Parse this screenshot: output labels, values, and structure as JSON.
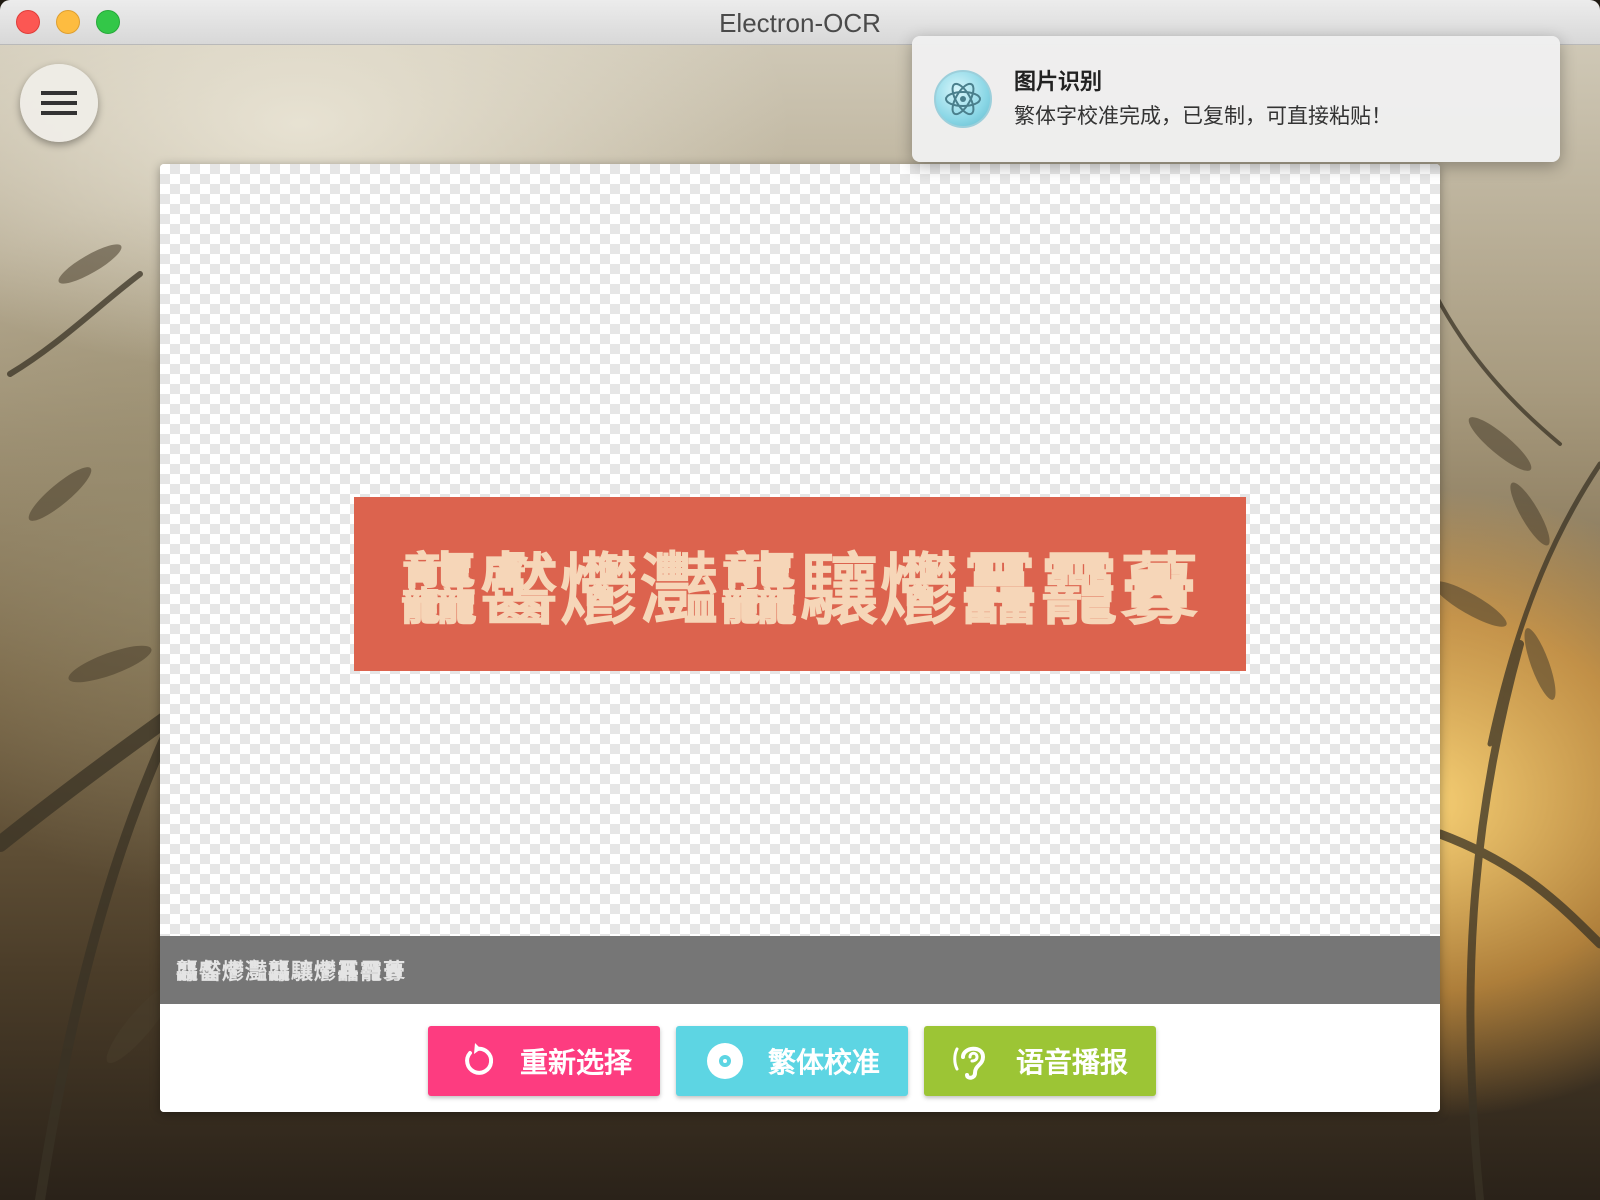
{
  "window": {
    "title": "Electron-OCR"
  },
  "notification": {
    "title": "图片识别",
    "message": "繁体字校准完成，已复制，可直接粘贴！",
    "icon": "electron-atom-icon"
  },
  "menu": {
    "icon": "hamburger-menu-icon"
  },
  "image": {
    "text": "龘齾爩灩龘驤爩靐龗虋"
  },
  "result": {
    "text": "龘齾爩灩龘驤爩靐龗虋"
  },
  "actions": {
    "reselect": {
      "label": "重新选择",
      "icon": "reload-icon",
      "color": "#fd3c80"
    },
    "calibrate": {
      "label": "繁体校准",
      "icon": "disc-icon",
      "color": "#5dd5e3"
    },
    "speak": {
      "label": "语音播报",
      "icon": "ear-icon",
      "color": "#9cc535"
    }
  }
}
